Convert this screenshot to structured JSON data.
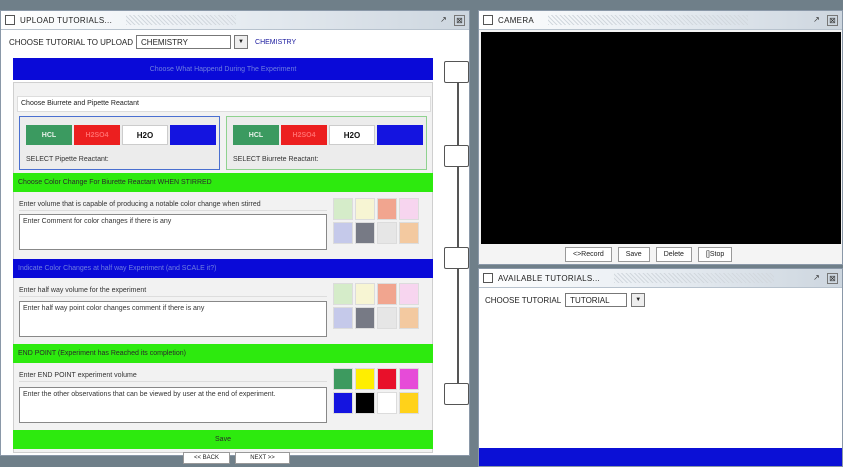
{
  "upload": {
    "title": "UPLOAD TUTORIALS...",
    "choose_label": "CHOOSE TUTORIAL TO UPLOAD",
    "tutorial_select": "CHEMISTRY",
    "selected_label": "CHEMISTRY",
    "header_bar": "Choose What Happend During The Experiment",
    "reactants_title": "Choose Biurrete and Pipette Reactant",
    "reactants": [
      "HCL",
      "H2SO4",
      "H2O",
      ""
    ],
    "pipette_label": "SELECT Pipette Reactant:",
    "burette_label": "SELECT Biurrete Reactant:",
    "stirred": {
      "bar": "Choose Color Change For Biurette Reactant WHEN STIRRED",
      "volume": "Enter volume that is capable of producing a notable color change when stirred",
      "comment": "Enter Comment for color changes if there is any"
    },
    "halfway": {
      "bar": "Indicate Color Changes at half way Experiment (and SCALE it?)",
      "volume": "Enter half way volume for the experiment",
      "comment": "Enter half way point color changes comment if there is any"
    },
    "endpoint": {
      "bar": "END POINT (Experiment has Reached its completion)",
      "volume": "Enter END POINT experiment volume",
      "comment": "Enter the other observations that can be viewed by user at the end of experiment."
    },
    "save_label": "Save",
    "back_label": "<< BACK",
    "next_label": "NEXT >>"
  },
  "camera": {
    "title": "CAMERA",
    "record_label": "<>Record",
    "save_label": "Save",
    "delete_label": "Delete",
    "stop_label": "[]Stop"
  },
  "available": {
    "title": "AVAILABLE TUTORIALS...",
    "choose_label": "CHOOSE TUTORIAL",
    "tutorial_select": "TUTORIAL"
  },
  "colors": {
    "pastel_palette": [
      "#d5ecc9",
      "#f7f5d3",
      "#f1a58f",
      "#f7d5ef",
      "#c5c9ea",
      "#777a85",
      "#e6e6e6",
      "#f3c9a0"
    ],
    "end_palette": [
      "#3d9a5f",
      "#ffee00",
      "#e8102a",
      "#e64bd8",
      "#1414e0",
      "#000000",
      "#ffffff",
      "#ffd21a"
    ],
    "blue_bar": "#0a0ad8",
    "green_bar": "#2dea0e"
  }
}
